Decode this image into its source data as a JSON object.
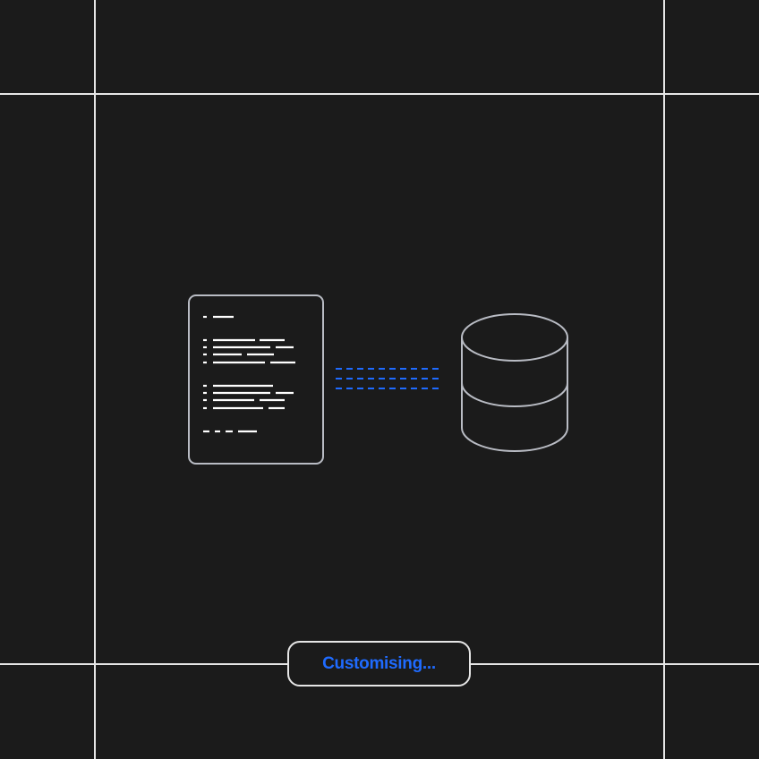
{
  "status": {
    "label": "Customising..."
  },
  "icons": {
    "document": "document-icon",
    "database": "database-icon",
    "connector": "data-flow-lines"
  },
  "colors": {
    "background": "#1b1b1b",
    "line": "#e6e6e6",
    "outline": "#b9bcc4",
    "accent": "#1f6bff"
  }
}
